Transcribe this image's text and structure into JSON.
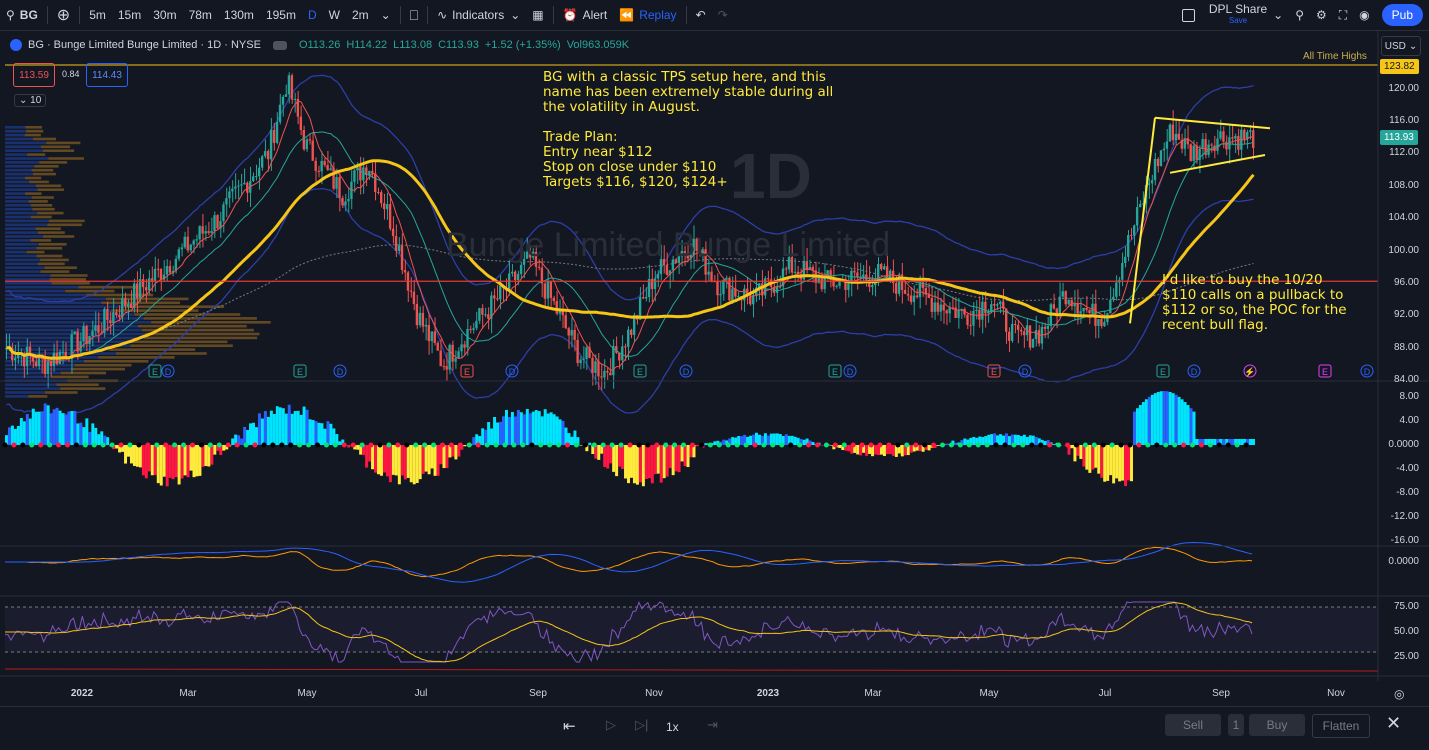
{
  "toolbar": {
    "symbol": "BG",
    "intervals": [
      "5m",
      "15m",
      "30m",
      "78m",
      "130m",
      "195m",
      "D",
      "W",
      "2m"
    ],
    "indicators_label": "Indicators",
    "alert_label": "Alert",
    "replay_label": "Replay",
    "layout_name": "DPL Share",
    "layout_sub": "Save",
    "publish_label": "Pub"
  },
  "legend": {
    "title": "BG · Bunge Limited Bunge Limited · 1D · NYSE",
    "open": "O113.26",
    "high": "H114.22",
    "low": "L113.08",
    "close": "C113.93",
    "change": "+1.52 (+1.35%)",
    "volume": "Vol963.059K",
    "bid": "113.59",
    "spread": "0.84",
    "ask": "114.43",
    "indicator_count": "10"
  },
  "watermark": {
    "text": "1D",
    "name": "Bunge Limited Bunge Limited"
  },
  "price_axis": {
    "currency": "USD",
    "labels": [
      "120.00",
      "116.00",
      "112.00",
      "108.00",
      "104.00",
      "100.00",
      "96.00",
      "92.00",
      "88.00",
      "84.00"
    ],
    "last_price": "113.93",
    "ath": "123.82",
    "ath_label": "All Time Highs"
  },
  "osc1_axis": [
    "8.00",
    "4.00",
    "0.0000",
    "-4.00",
    "-8.00",
    "-12.00",
    "-16.00"
  ],
  "osc2_axis": [
    "0.0000"
  ],
  "rsi_axis": [
    "75.00",
    "50.00",
    "25.00"
  ],
  "time_axis": [
    "2022",
    "Mar",
    "May",
    "Jul",
    "Sep",
    "Nov",
    "2023",
    "Mar",
    "May",
    "Jul",
    "Sep",
    "Nov"
  ],
  "notes": {
    "top": "BG with a classic TPS setup here, and this\nname has been extremely stable during all\nthe volatility in August.\n\nTrade Plan:\nEntry near $112\nStop on close under $110\nTargets $116, $120, $124+",
    "right": "I'd like to buy the 10/20\n$110 calls on a pullback to\n$112 or so, the POC for the\nrecent bull flag."
  },
  "replay": {
    "speed": "1x",
    "sell_label": "Sell",
    "qty": "1",
    "buy_label": "Buy",
    "flatten_label": "Flatten"
  },
  "colors": {
    "bg": "#131722",
    "up": "#26a69a",
    "down": "#ef5350",
    "accent": "#2962ff",
    "annotation": "#ffeb3b",
    "ma_yellow": "#f5c518",
    "bands": "#2c3ea8"
  }
}
